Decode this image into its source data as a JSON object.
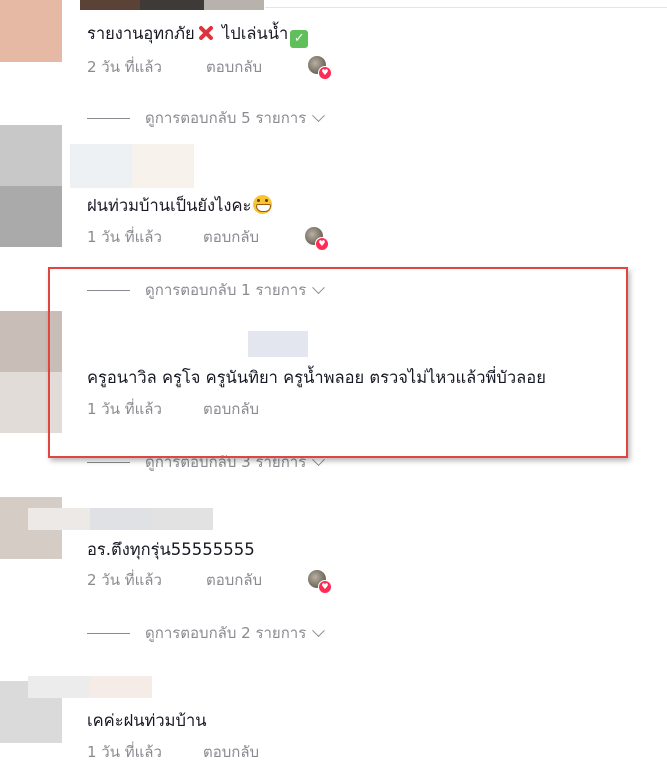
{
  "colors": {
    "text_primary": "#161823",
    "text_secondary": "#8a8b91",
    "like_heart": "#fe2c55",
    "highlight_border": "#e0453f"
  },
  "comments": [
    {
      "text_part1": "รายงานอุทกภัย",
      "emoji1": "cross-mark-emoji",
      "text_part2": " ไปเล่นน้ำ",
      "emoji2": "check-mark-emoji",
      "time": "2 วัน ที่แล้ว",
      "reply": "ตอบกลับ",
      "liked_by_creator": true,
      "view_replies": "ดูการตอบกลับ 5 รายการ"
    },
    {
      "text": "ฝนท่วมบ้านเป็นยังไงคะ",
      "emoji": "grinning-face-emoji",
      "time": "1 วัน ที่แล้ว",
      "reply": "ตอบกลับ",
      "liked_by_creator": true,
      "view_replies": "ดูการตอบกลับ 1 รายการ"
    },
    {
      "text": "ครูอนาวิล ครูโจ ครูนันทิยา ครูน้ำพลอย ตรวจไม่ไหวแล้วพี่บัวลอย",
      "time": "1 วัน ที่แล้ว",
      "reply": "ตอบกลับ",
      "liked_by_creator": false,
      "view_replies": "ดูการตอบกลับ 3 รายการ",
      "highlighted": true
    },
    {
      "text": "อร.ตึงทุกรุ่น55555555",
      "time": "2 วัน ที่แล้ว",
      "reply": "ตอบกลับ",
      "liked_by_creator": true,
      "view_replies": "ดูการตอบกลับ 2 รายการ"
    },
    {
      "text": "เคค่ะฝนท่วมบ้าน",
      "time": "1 วัน ที่แล้ว",
      "reply": "ตอบกลับ",
      "liked_by_creator": false
    }
  ]
}
